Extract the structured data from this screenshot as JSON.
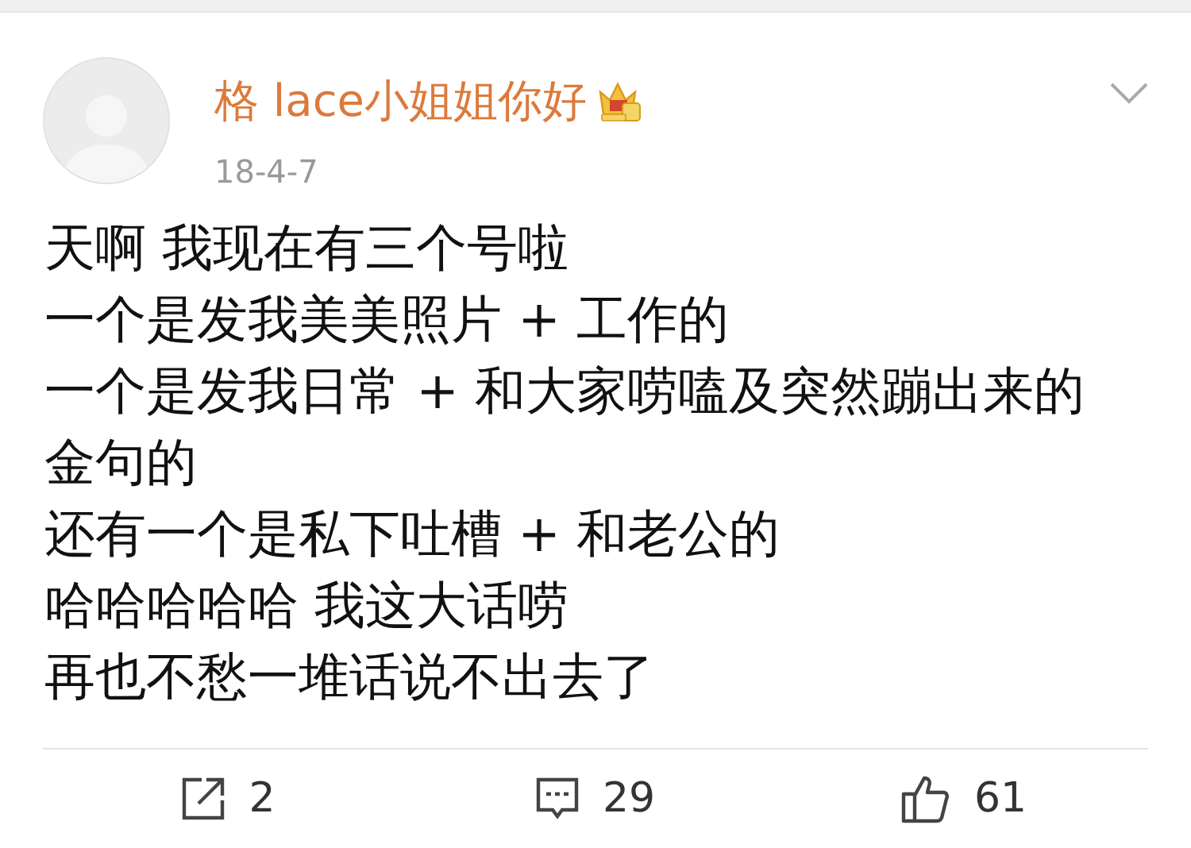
{
  "post": {
    "author": "格 lace小姐姐你好",
    "date": "18-4-7",
    "lines": [
      "天啊 我现在有三个号啦",
      "一个是发我美美照片 + 工作的",
      "一个是发我日常 + 和大家唠嗑及突然蹦出来的金句的",
      "还有一个是私下吐槽 + 和老公的",
      "哈哈哈哈哈 我这大话唠",
      "再也不愁一堆话说不出去了"
    ]
  },
  "actions": [
    {
      "kind": "share",
      "count": "2"
    },
    {
      "kind": "comment",
      "count": "29"
    },
    {
      "kind": "like",
      "count": "61"
    }
  ]
}
